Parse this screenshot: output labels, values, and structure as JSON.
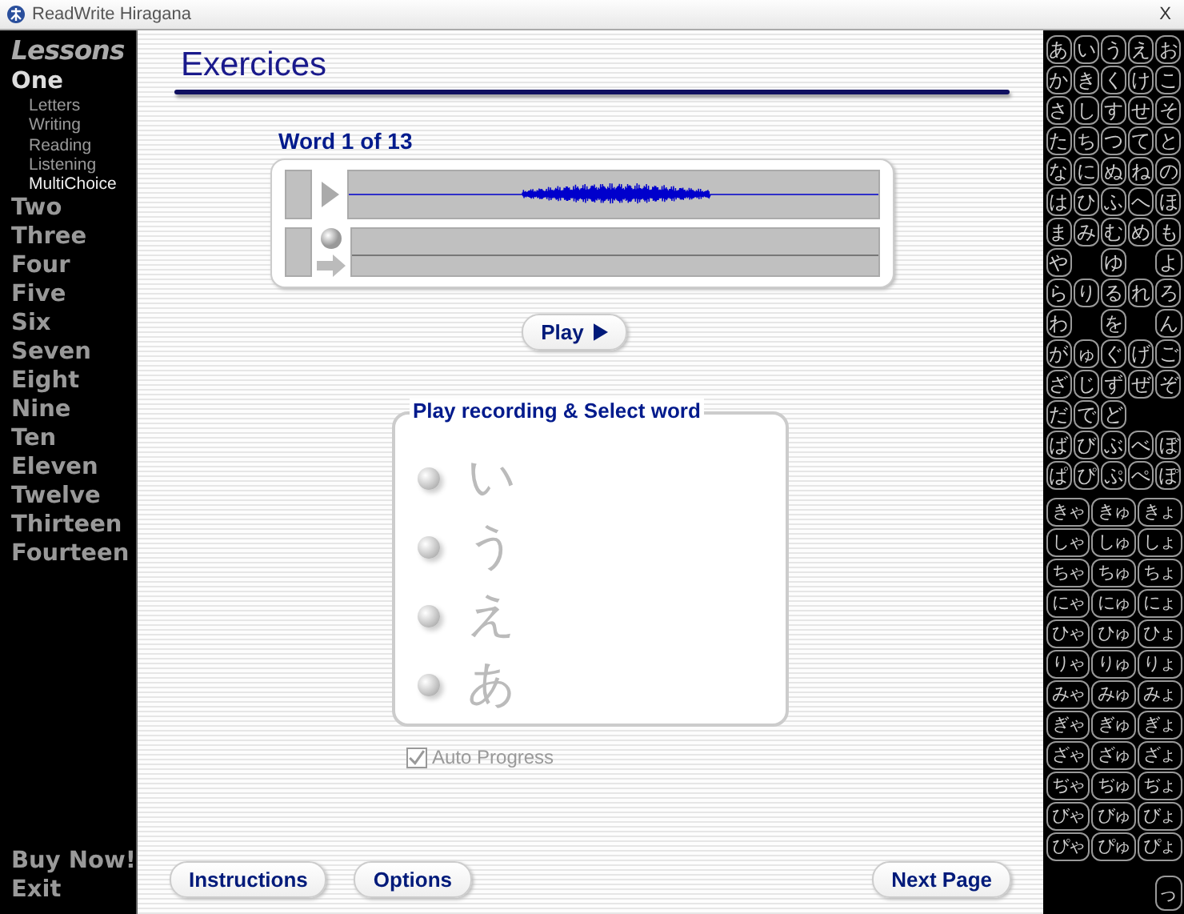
{
  "window": {
    "title": "ReadWrite Hiragana",
    "close": "X"
  },
  "sidebar": {
    "heading": "Lessons",
    "lessons": [
      {
        "label": "One",
        "selected": true,
        "expanded": true,
        "children": [
          {
            "label": "Letters",
            "selected": false
          },
          {
            "label": "Writing",
            "selected": false
          },
          {
            "label": "Reading",
            "selected": false
          },
          {
            "label": "Listening",
            "selected": false
          },
          {
            "label": "MultiChoice",
            "selected": true
          }
        ]
      },
      {
        "label": "Two",
        "selected": false,
        "expanded": false
      },
      {
        "label": "Three",
        "selected": false,
        "expanded": false
      },
      {
        "label": "Four",
        "selected": false,
        "expanded": false
      },
      {
        "label": "Five",
        "selected": false,
        "expanded": false
      },
      {
        "label": "Six",
        "selected": false,
        "expanded": false
      },
      {
        "label": "Seven",
        "selected": false,
        "expanded": false
      },
      {
        "label": "Eight",
        "selected": false,
        "expanded": false
      },
      {
        "label": "Nine",
        "selected": false,
        "expanded": false
      },
      {
        "label": "Ten",
        "selected": false,
        "expanded": false
      },
      {
        "label": "Eleven",
        "selected": false,
        "expanded": false
      },
      {
        "label": "Twelve",
        "selected": false,
        "expanded": false
      },
      {
        "label": "Thirteen",
        "selected": false,
        "expanded": false
      },
      {
        "label": "Fourteen",
        "selected": false,
        "expanded": false
      }
    ],
    "footer_links": [
      "Buy Now!",
      "Exit"
    ]
  },
  "page": {
    "title": "Exercices",
    "word_counter": "Word 1 of 13",
    "play_button": "Play",
    "choice_group": {
      "legend": "Play recording & Select word",
      "options": [
        {
          "label": "い",
          "selected": false
        },
        {
          "label": "う",
          "selected": false
        },
        {
          "label": "え",
          "selected": false
        },
        {
          "label": "あ",
          "selected": false
        }
      ]
    },
    "auto_progress": {
      "label": "Auto Progress",
      "checked": true,
      "disabled": true
    },
    "buttons": [
      "Instructions",
      "Options",
      "Next Page"
    ]
  },
  "kana_keys": [
    {
      "kind": "packed",
      "keys": [
        "あ",
        "い",
        "う",
        "え",
        "お"
      ]
    },
    {
      "kind": "packed",
      "keys": [
        "か",
        "き",
        "く",
        "け",
        "こ"
      ]
    },
    {
      "kind": "packed",
      "keys": [
        "さ",
        "し",
        "す",
        "せ",
        "そ"
      ]
    },
    {
      "kind": "packed",
      "keys": [
        "た",
        "ち",
        "つ",
        "て",
        "と"
      ]
    },
    {
      "kind": "packed",
      "keys": [
        "な",
        "に",
        "ぬ",
        "ね",
        "の"
      ]
    },
    {
      "kind": "packed",
      "keys": [
        "は",
        "ひ",
        "ふ",
        "へ",
        "ほ"
      ]
    },
    {
      "kind": "packed",
      "keys": [
        "ま",
        "み",
        "む",
        "め",
        "も"
      ]
    },
    {
      "kind": "spaced",
      "keys": [
        "や",
        "ゆ",
        "よ"
      ]
    },
    {
      "kind": "packed",
      "keys": [
        "ら",
        "り",
        "る",
        "れ",
        "ろ"
      ]
    },
    {
      "kind": "spaced",
      "keys": [
        "わ",
        "を",
        "ん"
      ]
    },
    {
      "kind": "packed",
      "keys": [
        "が",
        "ゅ",
        "ぐ",
        "げ",
        "ご"
      ]
    },
    {
      "kind": "packed",
      "keys": [
        "ざ",
        "じ",
        "ず",
        "ぜ",
        "ぞ"
      ]
    },
    {
      "kind": "packed",
      "keys": [
        "だ",
        "で",
        "ど"
      ]
    },
    {
      "kind": "packed",
      "keys": [
        "ば",
        "び",
        "ぶ",
        "べ",
        "ぼ"
      ]
    },
    {
      "kind": "packed",
      "keys": [
        "ぱ",
        "ぴ",
        "ぷ",
        "ぺ",
        "ぽ"
      ]
    }
  ],
  "yoon_keys": [
    [
      "きゃ",
      "きゅ",
      "きょ"
    ],
    [
      "しゃ",
      "しゅ",
      "しょ"
    ],
    [
      "ちゃ",
      "ちゅ",
      "ちょ"
    ],
    [
      "にゃ",
      "にゅ",
      "にょ"
    ],
    [
      "ひゃ",
      "ひゅ",
      "ひょ"
    ],
    [
      "りゃ",
      "りゅ",
      "りょ"
    ],
    [
      "みゃ",
      "みゅ",
      "みょ"
    ],
    [
      "ぎゃ",
      "ぎゅ",
      "ぎょ"
    ],
    [
      "ざゃ",
      "ざゅ",
      "ざょ"
    ],
    [
      "ぢゃ",
      "ぢゅ",
      "ぢょ"
    ],
    [
      "びゃ",
      "びゅ",
      "びょ"
    ],
    [
      "ぴゃ",
      "ぴゅ",
      "ぴょ"
    ]
  ],
  "extra_key": "っ"
}
